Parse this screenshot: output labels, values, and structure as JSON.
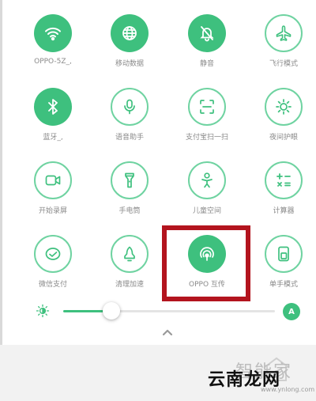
{
  "tiles": [
    {
      "label": "OPPO-5Z_, ",
      "icon": "wifi-icon",
      "active": true
    },
    {
      "label": "移动数据",
      "icon": "globe-icon",
      "active": true
    },
    {
      "label": "静音",
      "icon": "silent-bell-icon",
      "active": true
    },
    {
      "label": "飞行模式",
      "icon": "airplane-icon",
      "active": false
    },
    {
      "label": "蓝牙_, ",
      "icon": "bluetooth-icon",
      "active": true
    },
    {
      "label": "语音助手",
      "icon": "microphone-icon",
      "active": false
    },
    {
      "label": "支付宝扫一扫",
      "icon": "scan-icon",
      "active": false
    },
    {
      "label": "夜间护眼",
      "icon": "eye-comfort-icon",
      "active": false
    },
    {
      "label": "开始录屏",
      "icon": "screen-record-icon",
      "active": false
    },
    {
      "label": "手电筒",
      "icon": "flashlight-icon",
      "active": false
    },
    {
      "label": "儿童空间",
      "icon": "child-space-icon",
      "active": false
    },
    {
      "label": "计算器",
      "icon": "calculator-icon",
      "active": false
    },
    {
      "label": "微信支付",
      "icon": "wechat-pay-icon",
      "active": false
    },
    {
      "label": "清理加速",
      "icon": "clean-boost-icon",
      "active": false
    },
    {
      "label": "OPPO 互传",
      "icon": "oppo-share-icon",
      "active": true
    },
    {
      "label": "单手模式",
      "icon": "one-hand-icon",
      "active": false
    }
  ],
  "brightness": {
    "level": 0.2,
    "auto_label": "A"
  },
  "colors": {
    "accent": "#3ec07e",
    "highlight": "#b3141e"
  },
  "watermark": {
    "logo_text": "智能家",
    "site_name": "云南龙网",
    "url": "www.ynlong.com"
  }
}
